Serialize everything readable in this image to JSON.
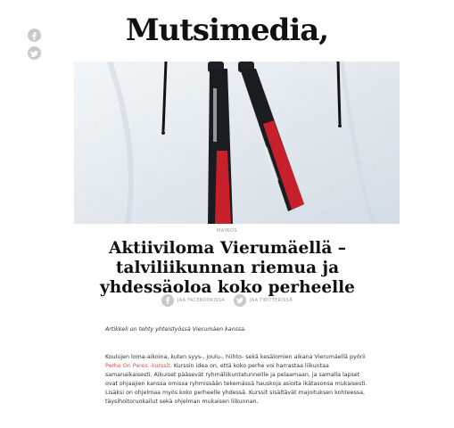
{
  "site": {
    "logo": "Mutsimedia,"
  },
  "social_rail": {
    "items": [
      {
        "icon": "facebook-icon"
      },
      {
        "icon": "twitter-icon"
      }
    ]
  },
  "article": {
    "category": "MAINOS",
    "title": "Aktiiviloma Vierumäellä – talviliikunnan riemua ja yhdessäoloa koko perheelle",
    "share": {
      "facebook_label": "JAA FACEBOOKISSA",
      "twitter_label": "JAA TWITTERISSÄ"
    },
    "intro": "Artikkeli on tehty yhteistyössä Vierumäen kanssa.",
    "body_part1": "Koulujen loma-aikoina, kuten syys-, joulu-, hiihto- sekä kesälomien aikana Vierumäellä pyörii ",
    "body_link": "Perhe On Peres -kurssit",
    "body_part2": ". Kurssin idea on, että koko perhe voi harrastaa liikuntaa samanaikaisesti. Aikuiset pääsevät ryhmäliikuntatunneille ja pelaamaan, ja samalla lapset ovat ohjaajien kanssa omissa ryhmissään tekemässä hauskoja asioita ikätasonsa mukaisesti. Lisäksi on ohjelmaa myös koko perheelle yhdessä. Kurssit sisältävät majoituksen kohteessa, täysihoitoruokailut sekä ohjelman mukaisen liikunnan."
  },
  "colors": {
    "accent_link": "#d9534f",
    "icon_grey": "#c9c9c9"
  }
}
